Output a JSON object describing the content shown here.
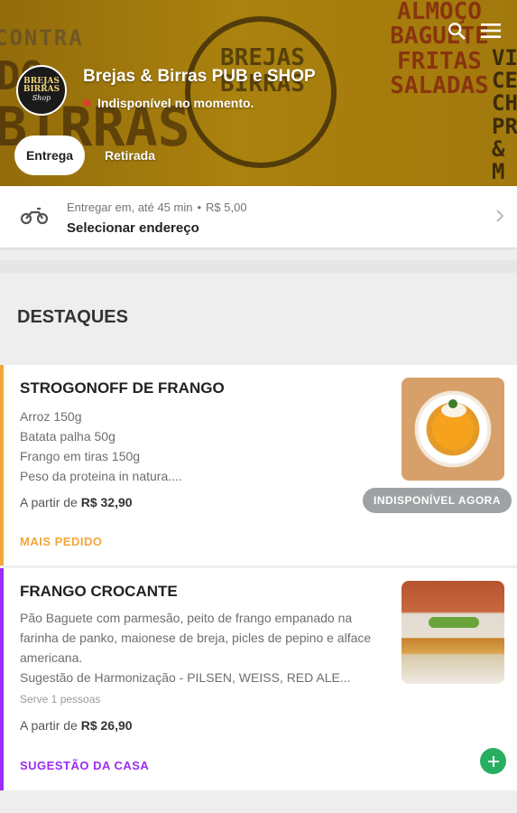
{
  "store": {
    "name": "Brejas & Birras PUB e SHOP",
    "status": "Indisponível no momento.",
    "logo_line1": "BREJAS BIRRAS",
    "logo_line2": "Shop",
    "status_color": "#e53935"
  },
  "hero": {
    "wall_contra": "CONTRA",
    "wall_do": "DO",
    "wall_birras": "BIRRAS",
    "wall_menu": "ALMOÇO BAGUETE FRITAS SALADAS",
    "wall_side": "VIN CE CH PRO & M",
    "wall_circle": "BREJAS BIRRAS"
  },
  "tabs": [
    {
      "label": "Entrega",
      "selected": true
    },
    {
      "label": "Retirada",
      "selected": false
    }
  ],
  "icons": {
    "search": "search-icon",
    "menu": "menu-icon",
    "moto": "motorcycle-icon",
    "chevron": "chevron-right-icon",
    "add": "plus-icon"
  },
  "delivery": {
    "label": "Entregar em, até 45 min",
    "separator": "•",
    "fee": "R$ 5,00",
    "select_address": "Selecionar endereço"
  },
  "section": {
    "title": "DESTAQUES"
  },
  "products": [
    {
      "name": "STROGONOFF DE FRANGO",
      "description_lines": [
        "Arroz 150g",
        "Batata palha 50g",
        "Frango em tiras 150g",
        "Peso da proteina in natura...."
      ],
      "price_prefix": "A partir de",
      "price": "R$ 32,90",
      "tag": "MAIS PEDIDO",
      "tag_color": "#f2a63a",
      "availability": "INDISPONÍVEL AGORA"
    },
    {
      "name": "FRANGO CROCANTE",
      "description": "Pão Baguete com parmesão, peito de frango empanado na farinha de panko, maionese de breja, picles de pepino e alface americana.",
      "harmonization": "Sugestão de Harmonização - PILSEN, WEISS, RED ALE...",
      "serves": "Serve 1 pessoas",
      "price_prefix": "A partir de",
      "price": "R$ 26,90",
      "tag": "SUGESTÃO DA CASA",
      "tag_color": "#9b2cf5"
    }
  ],
  "colors": {
    "add_button": "#27ae60",
    "unavailable_badge": "#9ea2a4"
  }
}
